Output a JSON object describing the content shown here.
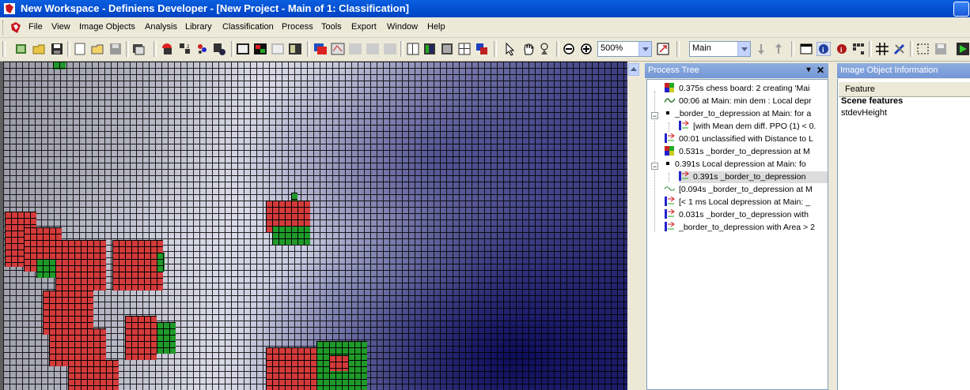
{
  "window": {
    "title": "New Workspace - Definiens Developer - [New Project - Main of 1: Classification]"
  },
  "menu": {
    "items": [
      "File",
      "View",
      "Image Objects",
      "Analysis",
      "Library",
      "Classification",
      "Process",
      "Tools",
      "Export",
      "Window",
      "Help"
    ]
  },
  "toolbar": {
    "zoom_value": "500%",
    "level_value": "Main"
  },
  "process_tree": {
    "title": "Process Tree",
    "rows": [
      "0.375s    chess board: 2 creating 'Mai",
      "00:06    at Main: min dem : Local depr",
      "_border_to_depression at Main: for a",
      "[with Mean dem diff. PPO (1) < 0.",
      "00:01    unclassified with Distance to L",
      "0.531s    _border_to_depression at M",
      "0.391s    Local depression at Main: fo",
      "0.391s    _border_to_depression",
      "[0.094s    _border_to_depression at M",
      "[< 1 ms    Local depression at Main: _",
      "0.031s    _border_to_depression with",
      "_border_to_depression with Area > 2"
    ]
  },
  "image_object_info": {
    "title": "Image Object Information",
    "column_header": "Feature",
    "group": "Scene features",
    "feature": "stdevHeight"
  },
  "colors": {
    "titlebar": "#0453d4",
    "panel_header": "#7f9fd8",
    "red_objects": "#d33b3b",
    "green_objects": "#1f9a2a"
  }
}
